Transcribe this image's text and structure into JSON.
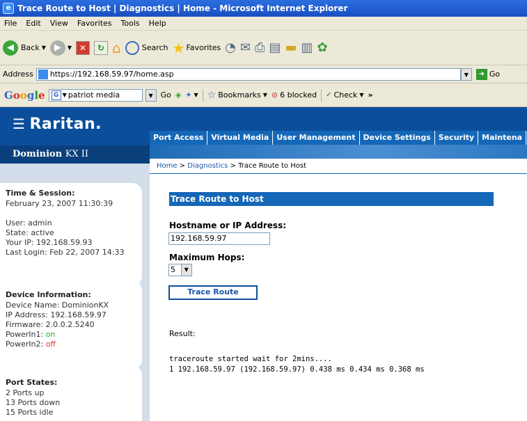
{
  "window": {
    "title": "Trace Route to Host | Diagnostics | Home - Microsoft Internet Explorer"
  },
  "menu": [
    "File",
    "Edit",
    "View",
    "Favorites",
    "Tools",
    "Help"
  ],
  "toolbar": {
    "back": "Back",
    "search": "Search",
    "favorites": "Favorites"
  },
  "address": {
    "label": "Address",
    "url": "https://192.168.59.97/home.asp",
    "go": "Go"
  },
  "googlebar": {
    "logo": [
      "G",
      "o",
      "o",
      "g",
      "l",
      "e"
    ],
    "search_text": "patriot media",
    "go": "Go",
    "bookmarks": "Bookmarks",
    "blocked": "6 blocked",
    "check": "Check",
    "more": "»"
  },
  "brand": {
    "logo": "Raritan.",
    "product": "Dominion",
    "product_suffix": "KX II"
  },
  "nav_tabs": [
    "Port Access",
    "Virtual Media",
    "User Management",
    "Device Settings",
    "Security",
    "Maintena"
  ],
  "breadcrumb": {
    "home": "Home",
    "sep": ">",
    "diag": "Diagnostics",
    "current": "Trace Route to Host"
  },
  "session": {
    "title": "Time & Session:",
    "datetime": "February 23, 2007 11:30:39",
    "user": "User: admin",
    "state": "State: active",
    "ip": "Your IP: 192.168.59.93",
    "last_login": "Last Login: Feb 22, 2007 14:33"
  },
  "device": {
    "title": "Device Information:",
    "name": "Device Name: DominionKX",
    "ip": "IP Address: 192.168.59.97",
    "firmware": "Firmware: 2.0.0.2.5240",
    "p1_label": "PowerIn1:",
    "p1_value": "on",
    "p2_label": "PowerIn2:",
    "p2_value": "off"
  },
  "ports": {
    "title": "Port States:",
    "up": "2 Ports up",
    "down": "13 Ports down",
    "idle": "15 Ports idle"
  },
  "form": {
    "section_title": "Trace Route to Host",
    "host_label": "Hostname or IP Address:",
    "host_value": "192.168.59.97",
    "hops_label": "Maximum Hops:",
    "hops_value": "5",
    "button": "Trace Route",
    "result_label": "Result:",
    "result_line1": "traceroute started wait for 2mins....",
    "result_line2": "1 192.168.59.97 (192.168.59.97) 0.438 ms 0.434 ms 0.368 ms"
  }
}
